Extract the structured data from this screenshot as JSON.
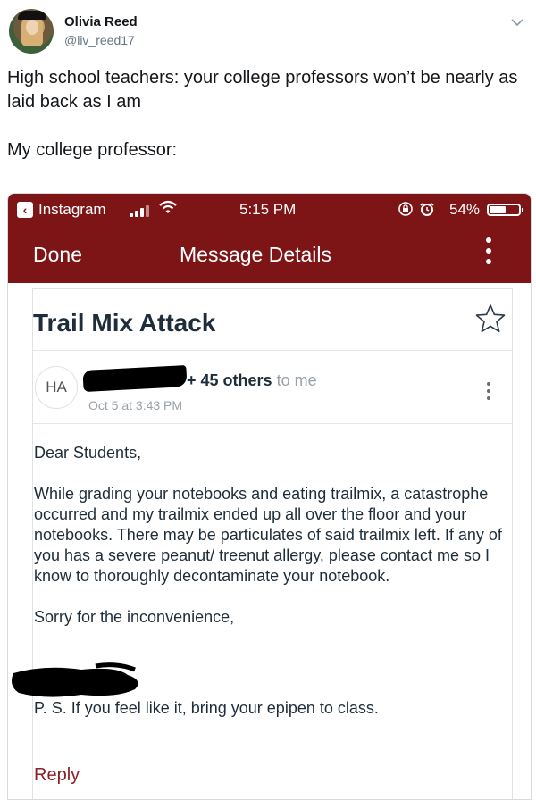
{
  "tweet": {
    "author_name": "Olivia Reed",
    "author_handle": "@liv_reed17",
    "text_line1": "High school teachers: your college professors won’t be nearly as laid back as I am",
    "text_line2": "My college professor:"
  },
  "screenshot": {
    "statusbar": {
      "back_app": "Instagram",
      "time": "5:15 PM",
      "battery": "54%",
      "battery_level": 0.54
    },
    "navbar": {
      "done": "Done",
      "title": "Message Details"
    },
    "email": {
      "subject": "Trail Mix Attack",
      "sender_initials": "HA",
      "recipients_suffix": "+ 45 others",
      "to_me": "to me",
      "date": "Oct 5 at 3:43 PM",
      "body": [
        "Dear Students,",
        "While grading your notebooks and eating trailmix, a catastrophe occurred and my trailmix ended up all over the floor and your notebooks. There may be particulates of said trailmix left. If any of you has a severe peanut/ treenut allergy, please contact me so I know  to thoroughly decontaminate your notebook.",
        "Sorry for the inconvenience,",
        "P. S. If you feel like it, bring your epipen to class."
      ],
      "reply": "Reply"
    }
  }
}
